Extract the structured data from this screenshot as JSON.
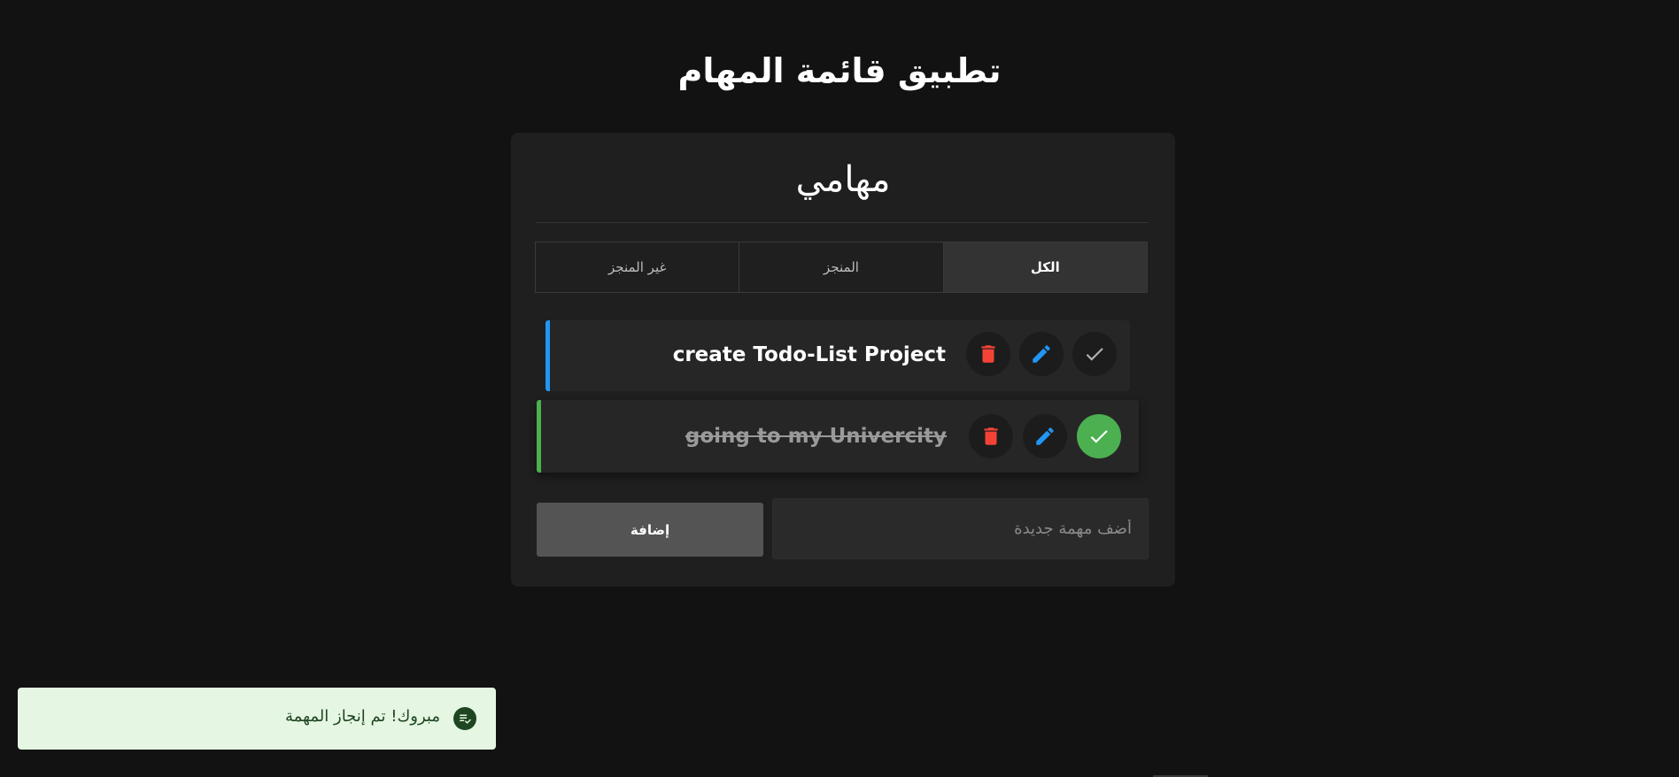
{
  "app": {
    "title": "تطبيق قائمة المهام"
  },
  "card": {
    "title": "مهامي"
  },
  "tabs": [
    {
      "label": "الكل",
      "active": true
    },
    {
      "label": "المنجز",
      "active": false
    },
    {
      "label": "غير المنجز",
      "active": false
    }
  ],
  "tasks": [
    {
      "text": "create Todo-List Project",
      "completed": false,
      "accent_color": "#2196f3",
      "icons": [
        "check-icon",
        "edit-icon",
        "delete-icon"
      ]
    },
    {
      "text": "going to my Univercity",
      "completed": true,
      "accent_color": "#4caf50",
      "icons": [
        "check-icon",
        "edit-icon",
        "delete-icon"
      ]
    }
  ],
  "add_task": {
    "placeholder": "أضف مهمة جديدة",
    "value": "",
    "button_label": "إضافة"
  },
  "toast": {
    "message": "مبروك! تم إنجاز المهمة",
    "icon": "task-done-icon"
  },
  "colors": {
    "background": "#121212",
    "card": "#1f1f1f",
    "delete": "#f44336",
    "edit": "#2196f3",
    "done": "#4caf50",
    "toast_bg": "#e5f6e3",
    "toast_text": "#1e4620"
  }
}
